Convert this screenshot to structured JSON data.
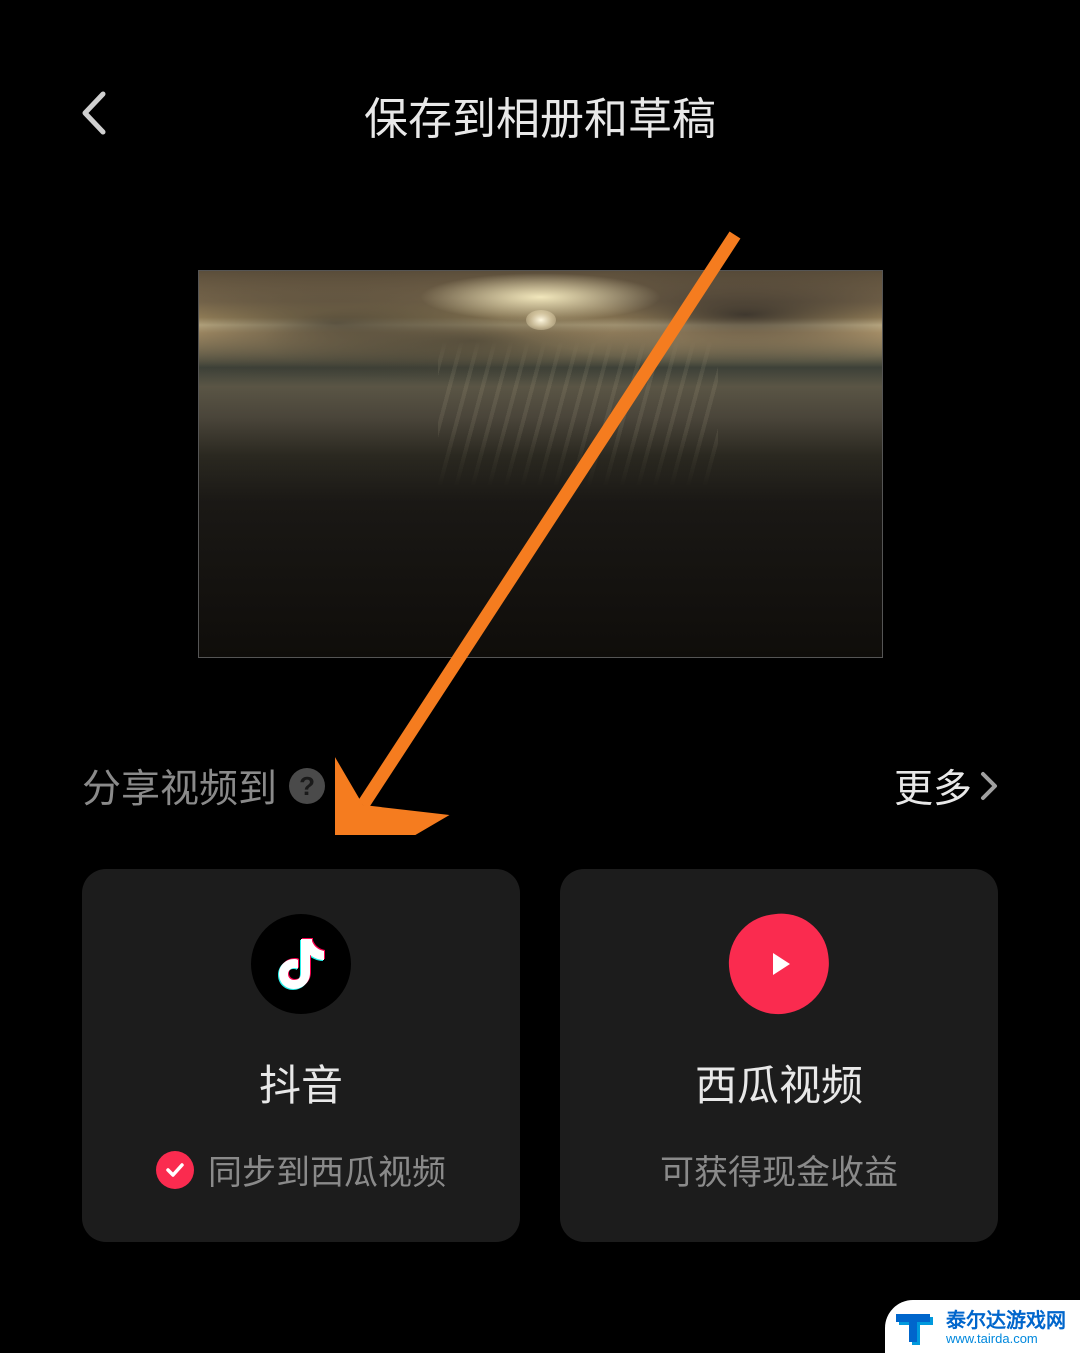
{
  "header": {
    "title": "保存到相册和草稿"
  },
  "share": {
    "label": "分享视频到",
    "more": "更多"
  },
  "cards": [
    {
      "name": "抖音",
      "subtext": "同步到西瓜视频",
      "has_check": true,
      "icon": "douyin"
    },
    {
      "name": "西瓜视频",
      "subtext": "可获得现金收益",
      "has_check": false,
      "icon": "xigua"
    }
  ],
  "watermark": {
    "name": "泰尔达游戏网",
    "url": "www.tairda.com"
  },
  "colors": {
    "accent": "#fa2b4f",
    "arrow": "#f57c1f"
  }
}
